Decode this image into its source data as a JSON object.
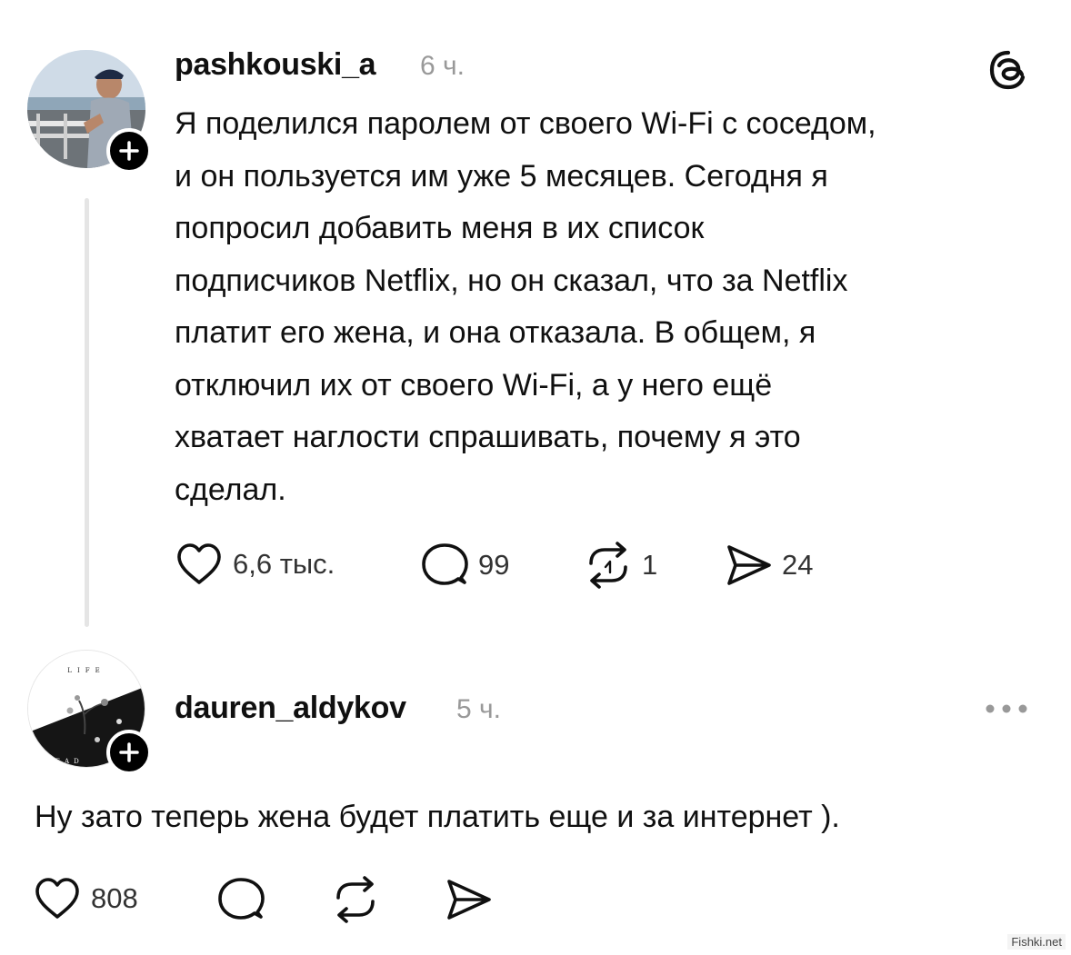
{
  "post": {
    "username": "pashkouski_a",
    "time": "6 ч.",
    "text": "Я поделился паролем от своего Wi-Fi с соседом,\nи он пользуется им уже 5 месяцев. Сегодня я\nпопросил добавить меня в их список\nподписчиков Netflix, но он сказал, что за Netflix\nплатит его жена, и она отказала. В общем, я\nотключил их от своего Wi-Fi, а у него ещё\nхватает наглости спрашивать, почему я это\nсделал.",
    "likes": "6,6 тыс.",
    "comments": "99",
    "reposts": "1",
    "shares": "24",
    "logo_icon": "threads-logo-icon"
  },
  "reply": {
    "username": "dauren_aldykov",
    "time": "5 ч.",
    "text": "Ну зато теперь жена будет платить еще и за интернет ).",
    "likes": "808",
    "avatar_text_top": "LIFE",
    "avatar_text_bottom": "DEAD"
  },
  "watermark": "Fishki.net",
  "colors": {
    "text": "#101010",
    "muted": "#999999",
    "thread_line": "#e5e5e5",
    "badge": "#000000"
  }
}
